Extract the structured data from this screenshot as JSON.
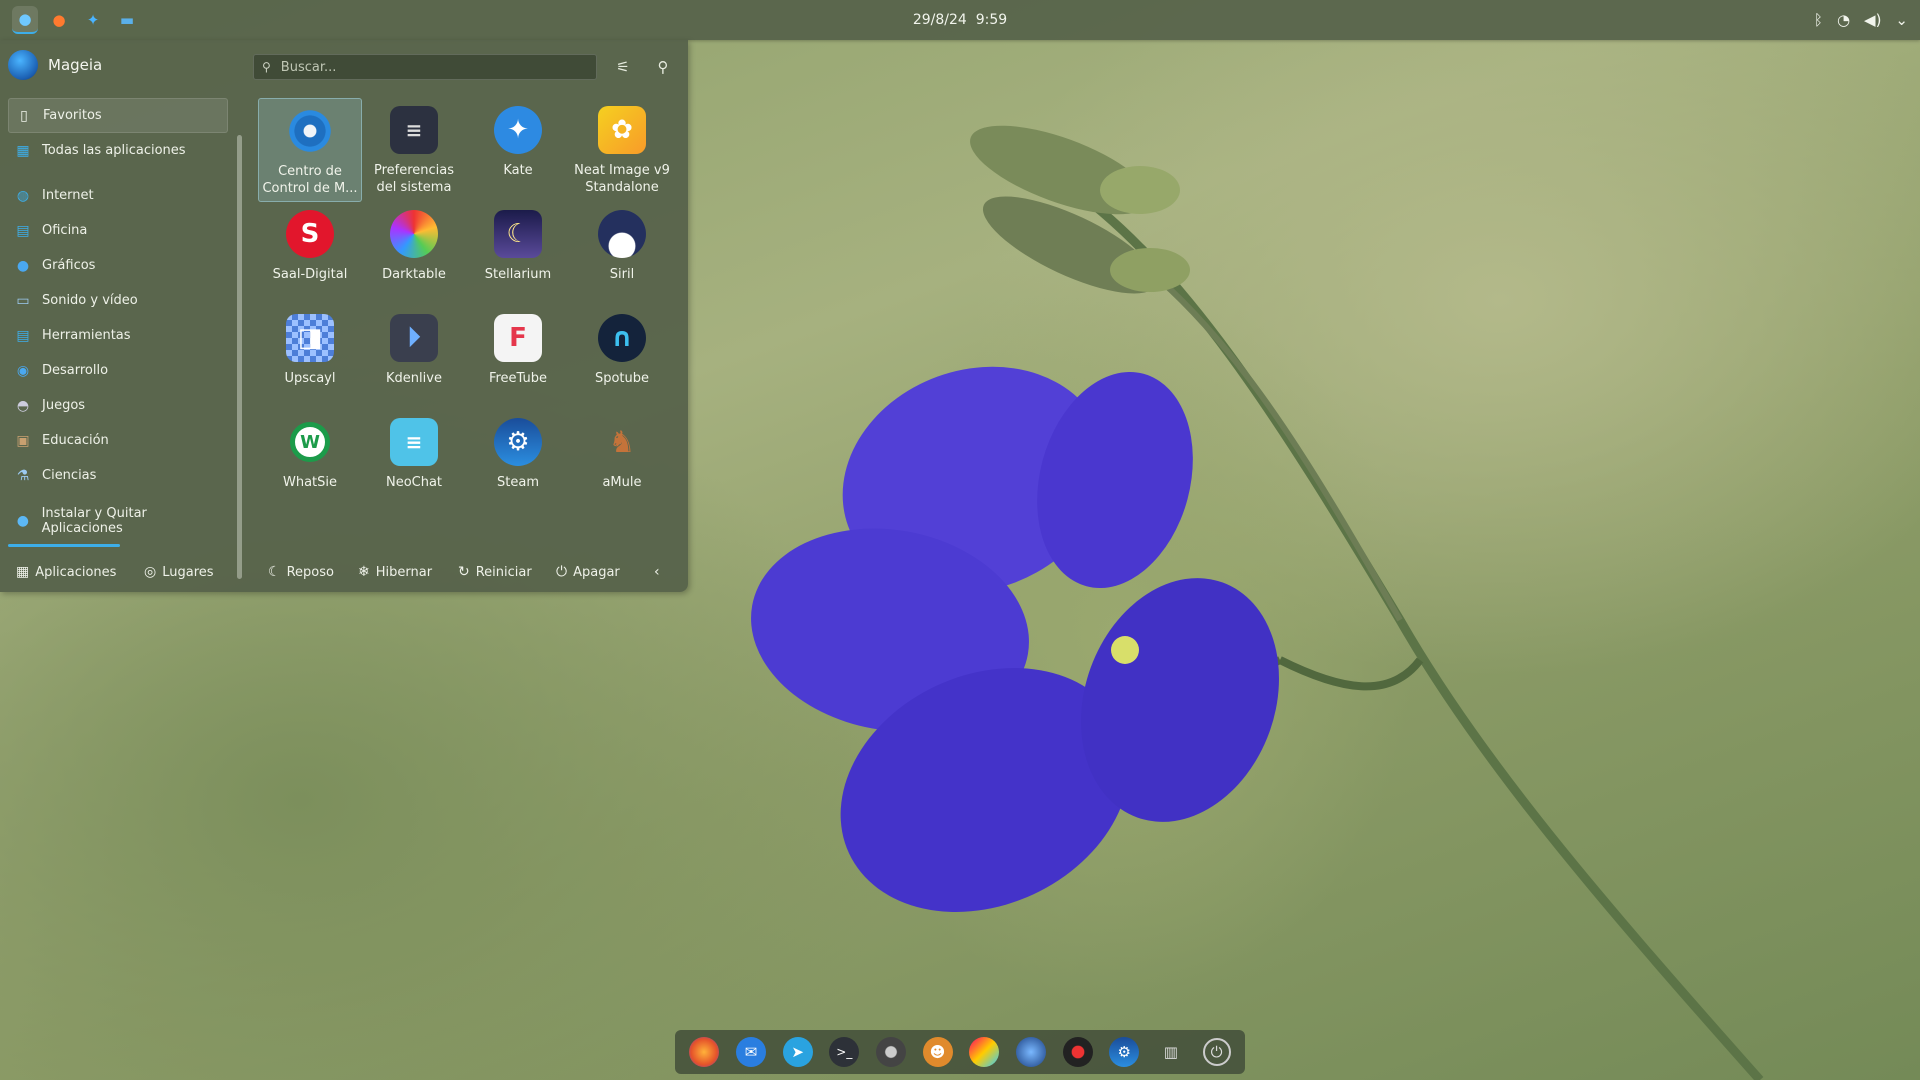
{
  "top_panel": {
    "date": "29/8/24",
    "time": "9:59",
    "launchers": [
      "app-menu-icon",
      "firefox-icon",
      "kate-icon",
      "files-icon"
    ],
    "tray": [
      "bluetooth-icon",
      "wifi-icon",
      "volume-icon",
      "chevron-down-icon"
    ]
  },
  "launcher": {
    "user": "Mageia",
    "search_placeholder": "Buscar...",
    "categories": [
      {
        "label": "Favoritos",
        "icon": "bookmark-icon"
      },
      {
        "label": "Todas las aplicaciones",
        "icon": "grid-icon"
      },
      {
        "label": "Internet",
        "icon": "globe-icon"
      },
      {
        "label": "Oficina",
        "icon": "office-icon"
      },
      {
        "label": "Gráficos",
        "icon": "graphics-icon"
      },
      {
        "label": "Sonido y vídeo",
        "icon": "multimedia-icon"
      },
      {
        "label": "Herramientas",
        "icon": "tools-icon"
      },
      {
        "label": "Desarrollo",
        "icon": "development-icon"
      },
      {
        "label": "Juegos",
        "icon": "gamepad-icon"
      },
      {
        "label": "Educación",
        "icon": "education-icon"
      },
      {
        "label": "Ciencias",
        "icon": "science-icon"
      },
      {
        "label": "Instalar y Quitar Aplicaciones",
        "icon": "install-icon"
      }
    ],
    "apps": [
      {
        "line1": "Centro de",
        "line2": "Control de M..."
      },
      {
        "line1": "Preferencias",
        "line2": "del sistema"
      },
      {
        "line1": "Kate",
        "line2": ""
      },
      {
        "line1": "Neat Image v9",
        "line2": "Standalone"
      },
      {
        "line1": "Saal-Digital",
        "line2": ""
      },
      {
        "line1": "Darktable",
        "line2": ""
      },
      {
        "line1": "Stellarium",
        "line2": ""
      },
      {
        "line1": "Siril",
        "line2": ""
      },
      {
        "line1": "Upscayl",
        "line2": ""
      },
      {
        "line1": "Kdenlive",
        "line2": ""
      },
      {
        "line1": "FreeTube",
        "line2": ""
      },
      {
        "line1": "Spotube",
        "line2": ""
      },
      {
        "line1": "WhatSie",
        "line2": ""
      },
      {
        "line1": "NeoChat",
        "line2": ""
      },
      {
        "line1": "Steam",
        "line2": ""
      },
      {
        "line1": "aMule",
        "line2": ""
      }
    ],
    "footer": {
      "apps_tab": "Aplicaciones",
      "places_tab": "Lugares",
      "sleep": "Reposo",
      "hibernate": "Hibernar",
      "restart": "Reiniciar",
      "shutdown": "Apagar"
    }
  },
  "dock": [
    "firefox-icon",
    "thunderbird-icon",
    "telegram-icon",
    "terminal-icon",
    "aperture-icon",
    "game-icon",
    "krita-icon",
    "siril-icon",
    "obs-icon",
    "steam-icon",
    "trash-icon",
    "power-icon"
  ]
}
